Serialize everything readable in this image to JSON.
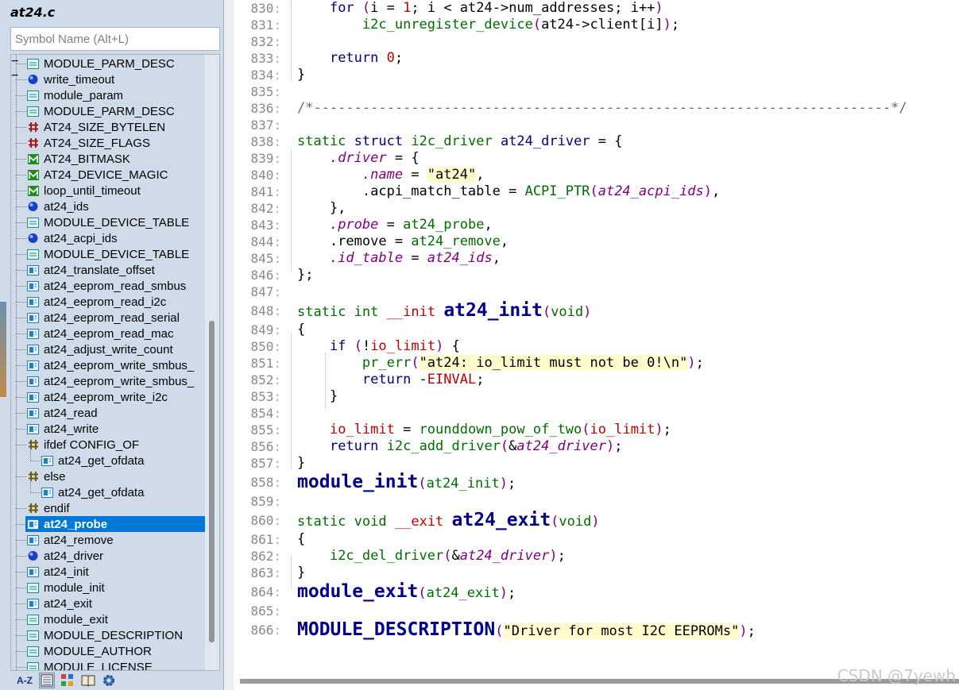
{
  "sidebar": {
    "file_title": "at24.c",
    "search_placeholder": "Symbol Name (Alt+L)",
    "items": [
      {
        "label": "MODULE_PARM_DESC",
        "icon": "macro-call-icon",
        "depth": 0
      },
      {
        "label": "write_timeout",
        "icon": "variable-icon",
        "depth": 0
      },
      {
        "label": "module_param",
        "icon": "macro-call-icon",
        "depth": 0
      },
      {
        "label": "MODULE_PARM_DESC",
        "icon": "macro-call-icon",
        "depth": 0
      },
      {
        "label": "AT24_SIZE_BYTELEN",
        "icon": "define-icon",
        "depth": 0
      },
      {
        "label": "AT24_SIZE_FLAGS",
        "icon": "define-icon",
        "depth": 0
      },
      {
        "label": "AT24_BITMASK",
        "icon": "macro-function-icon",
        "depth": 0
      },
      {
        "label": "AT24_DEVICE_MAGIC",
        "icon": "macro-function-icon",
        "depth": 0
      },
      {
        "label": "loop_until_timeout",
        "icon": "macro-function-icon",
        "depth": 0
      },
      {
        "label": "at24_ids",
        "icon": "variable-icon",
        "depth": 0
      },
      {
        "label": "MODULE_DEVICE_TABLE",
        "icon": "macro-call-icon",
        "depth": 0
      },
      {
        "label": "at24_acpi_ids",
        "icon": "variable-icon",
        "depth": 0
      },
      {
        "label": "MODULE_DEVICE_TABLE",
        "icon": "macro-call-icon",
        "depth": 0
      },
      {
        "label": "at24_translate_offset",
        "icon": "function-icon",
        "depth": 0
      },
      {
        "label": "at24_eeprom_read_smbus",
        "icon": "function-icon",
        "depth": 0
      },
      {
        "label": "at24_eeprom_read_i2c",
        "icon": "function-icon",
        "depth": 0
      },
      {
        "label": "at24_eeprom_read_serial",
        "icon": "function-icon",
        "depth": 0
      },
      {
        "label": "at24_eeprom_read_mac",
        "icon": "function-icon",
        "depth": 0
      },
      {
        "label": "at24_adjust_write_count",
        "icon": "function-icon",
        "depth": 0
      },
      {
        "label": "at24_eeprom_write_smbus_",
        "icon": "function-icon",
        "depth": 0
      },
      {
        "label": "at24_eeprom_write_smbus_",
        "icon": "function-icon",
        "depth": 0
      },
      {
        "label": "at24_eeprom_write_i2c",
        "icon": "function-icon",
        "depth": 0
      },
      {
        "label": "at24_read",
        "icon": "function-icon",
        "depth": 0
      },
      {
        "label": "at24_write",
        "icon": "function-icon",
        "depth": 0
      },
      {
        "label": "ifdef CONFIG_OF",
        "icon": "preprocessor-icon",
        "depth": 0,
        "expander": "−"
      },
      {
        "label": "at24_get_ofdata",
        "icon": "function-icon",
        "depth": 1
      },
      {
        "label": "else",
        "icon": "preprocessor-icon",
        "depth": 0,
        "expander": "−"
      },
      {
        "label": "at24_get_ofdata",
        "icon": "function-icon",
        "depth": 1
      },
      {
        "label": "endif",
        "icon": "preprocessor-icon",
        "depth": 0
      },
      {
        "label": "at24_probe",
        "icon": "function-icon",
        "depth": 0,
        "selected": true
      },
      {
        "label": "at24_remove",
        "icon": "function-icon",
        "depth": 0
      },
      {
        "label": "at24_driver",
        "icon": "variable-icon",
        "depth": 0
      },
      {
        "label": "at24_init",
        "icon": "function-icon",
        "depth": 0
      },
      {
        "label": "module_init",
        "icon": "macro-call-icon",
        "depth": 0
      },
      {
        "label": "at24_exit",
        "icon": "function-icon",
        "depth": 0
      },
      {
        "label": "module_exit",
        "icon": "macro-call-icon",
        "depth": 0
      },
      {
        "label": "MODULE_DESCRIPTION",
        "icon": "macro-call-icon",
        "depth": 0
      },
      {
        "label": "MODULE_AUTHOR",
        "icon": "macro-call-icon",
        "depth": 0
      },
      {
        "label": "MODULE_LICENSE",
        "icon": "macro-call-icon",
        "depth": 0
      }
    ],
    "toolbar": {
      "az_label": "A-Z"
    }
  },
  "editor": {
    "lines": [
      {
        "n": "830",
        "html": "    <span class='kw'>for</span> <span class='par'>(</span>i = <span class='num'>1</span>; i &lt; at24-&gt;num_addresses; i++<span class='par'>)</span>"
      },
      {
        "n": "831",
        "html": "        <span class='fn'>i2c_unregister_device</span><span class='par'>(</span>at24-&gt;client[i]<span class='par'>)</span>;"
      },
      {
        "n": "832",
        "html": ""
      },
      {
        "n": "833",
        "html": "    <span class='kw'>return</span> <span class='num'>0</span>;"
      },
      {
        "n": "834",
        "html": "}"
      },
      {
        "n": "835",
        "html": ""
      },
      {
        "n": "836",
        "html": "<span class='cmt'>/*-----------------------------------------------------------------------*/</span>"
      },
      {
        "n": "837",
        "html": ""
      },
      {
        "n": "838",
        "html": "<span class='ty'>static</span> <span class='kw'>struct</span> <span class='ty'>i2c_driver</span> <span class='mem'>at24_driver</span> = {"
      },
      {
        "n": "839",
        "html": "    <span class='it'>.driver</span> = {"
      },
      {
        "n": "840",
        "html": "        <span class='it'>.name</span> = <span class='str'>\"at24\"</span>,"
      },
      {
        "n": "841",
        "html": "        .acpi_match_table = <span class='fn'>ACPI_PTR</span><span class='par'>(</span><span class='it'>at24_acpi_ids</span><span class='par'>)</span>,"
      },
      {
        "n": "842",
        "html": "    },"
      },
      {
        "n": "843",
        "html": "    <span class='it'>.probe</span> = <span class='fn'>at24_probe</span>,"
      },
      {
        "n": "844",
        "html": "    .remove = <span class='fn'>at24_remove</span>,"
      },
      {
        "n": "845",
        "html": "    <span class='it'>.id_table</span> = <span class='it'>at24_ids</span>,"
      },
      {
        "n": "846",
        "html": "};"
      },
      {
        "n": "847",
        "html": ""
      },
      {
        "n": "848",
        "html": "<span class='ty'>static</span> <span class='ty'>int</span> <span class='red'>__init</span> <span class='fnbig'>at24_init</span><span class='par'>(</span><span class='ty'>void</span><span class='par'>)</span>",
        "tall": true
      },
      {
        "n": "849",
        "html": "{"
      },
      {
        "n": "850",
        "html": "    <span class='kw'>if</span> <span class='par'>(</span>!<span class='red'>io_limit</span><span class='par'>)</span> {"
      },
      {
        "n": "851",
        "html": "        <span class='fn'>pr_err</span><span class='par'>(</span><span class='str'>\"at24: io_limit must not be 0!\\n\"</span><span class='par'>)</span>;"
      },
      {
        "n": "852",
        "html": "        <span class='kw'>return</span> -<span class='red'>EINVAL</span>;"
      },
      {
        "n": "853",
        "html": "    }"
      },
      {
        "n": "854",
        "html": ""
      },
      {
        "n": "855",
        "html": "    <span class='red'>io_limit</span> = <span class='fn'>rounddown_pow_of_two</span><span class='par'>(</span><span class='red'>io_limit</span><span class='par'>)</span>;"
      },
      {
        "n": "856",
        "html": "    <span class='kw'>return</span> <span class='fn'>i2c_add_driver</span><span class='par'>(</span>&amp;<span class='it'>at24_driver</span><span class='par'>)</span>;"
      },
      {
        "n": "857",
        "html": "}"
      },
      {
        "n": "858",
        "html": "<span class='macbig'>module_init</span><span class='par'>(</span><span class='fn'>at24_init</span><span class='par'>)</span>;",
        "tall": true
      },
      {
        "n": "859",
        "html": ""
      },
      {
        "n": "860",
        "html": "<span class='ty'>static</span> <span class='ty'>void</span> <span class='red'>__exit</span> <span class='fnbig'>at24_exit</span><span class='par'>(</span><span class='ty'>void</span><span class='par'>)</span>",
        "tall": true
      },
      {
        "n": "861",
        "html": "{"
      },
      {
        "n": "862",
        "html": "    <span class='fn'>i2c_del_driver</span><span class='par'>(</span>&amp;<span class='it'>at24_driver</span><span class='par'>)</span>;"
      },
      {
        "n": "863",
        "html": "}"
      },
      {
        "n": "864",
        "html": "<span class='macbig'>module_exit</span><span class='par'>(</span><span class='fn'>at24_exit</span><span class='par'>)</span>;",
        "tall": true
      },
      {
        "n": "865",
        "html": ""
      },
      {
        "n": "866",
        "html": "<span class='macbig'>MODULE_DESCRIPTION</span><span class='par'>(</span><span class='str'>\"Driver for most I2C EEPROMs\"</span><span class='par'>)</span>;",
        "tall": true
      }
    ]
  },
  "watermark": "CSDN @7yewh"
}
